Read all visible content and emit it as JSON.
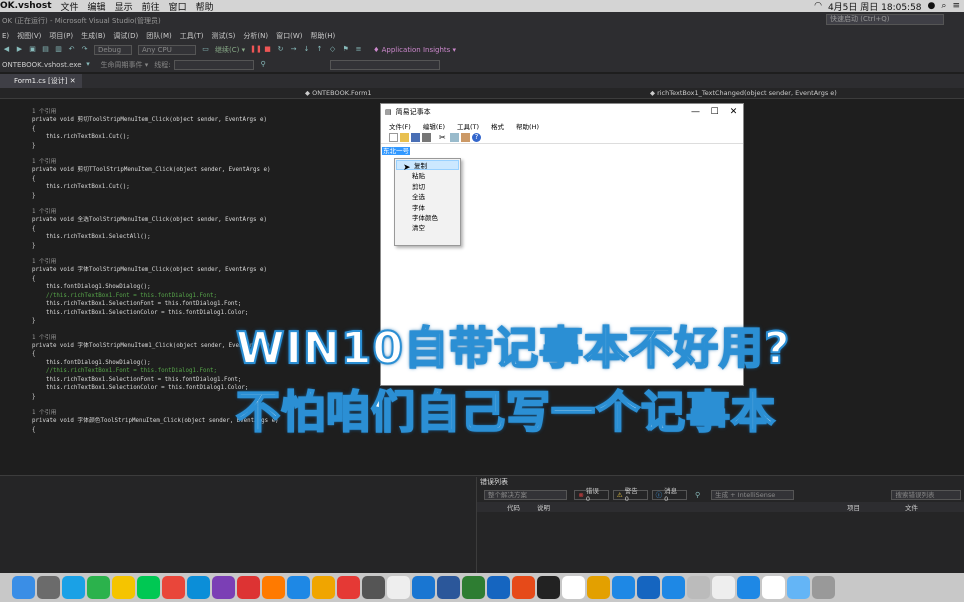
{
  "mac_menubar": {
    "app_name": "OK.vshost",
    "menus": [
      "文件",
      "编辑",
      "显示",
      "前往",
      "窗口",
      "帮助"
    ],
    "clock": "4月5日 周日 18:05:58"
  },
  "vs": {
    "window_title": "OK (正在运行) - Microsoft Visual Studio(管理员)",
    "quick_launch_placeholder": "快速启动 (Ctrl+Q)",
    "menu": [
      "E)",
      "视图(V)",
      "项目(P)",
      "生成(B)",
      "调试(D)",
      "团队(M)",
      "工具(T)",
      "测试(S)",
      "分析(N)",
      "窗口(W)",
      "帮助(H)"
    ],
    "config_combo": "Debug",
    "platform_combo": "Any CPU",
    "continue_label": "继续(C) ▾",
    "app_insights": "Application Insights",
    "process_combo": "ONTEBOOK.vshost.exe",
    "lifecycle_label": "生命周期事件 ▾",
    "thread_label": "线程:",
    "doc_tab": "Form1.cs [设计]",
    "nav_class": "ONTEBOOK.Form1",
    "nav_member": "richTextBox1_TextChanged(object sender, EventArgs e)"
  },
  "code_lines": [
    {
      "ref": "1 个引用",
      "text": "private void 剪切ToolStripMenuItem_Click(object sender, EventArgs e)"
    },
    {
      "text": "{"
    },
    {
      "text": "    this.richTextBox1.Cut();"
    },
    {
      "text": "}"
    },
    {
      "ref": "1 个引用",
      "text": "private void 剪切TToolStripMenuItem_Click(object sender, EventArgs e)"
    },
    {
      "text": "{"
    },
    {
      "text": "    this.richTextBox1.Cut();"
    },
    {
      "text": "}"
    },
    {
      "ref": "1 个引用",
      "text": "private void 全选ToolStripMenuItem_Click(object sender, EventArgs e)"
    },
    {
      "text": "{"
    },
    {
      "text": "    this.richTextBox1.SelectAll();"
    },
    {
      "text": "}"
    },
    {
      "ref": "1 个引用",
      "text": "private void 字体ToolStripMenuItem_Click(object sender, EventArgs e)"
    },
    {
      "text": "{"
    },
    {
      "text": "    this.fontDialog1.ShowDialog();"
    },
    {
      "text": "    //this.richTextBox1.Font = this.fontDialog1.Font;",
      "comment": true
    },
    {
      "text": "    this.richTextBox1.SelectionFont = this.fontDialog1.Font;"
    },
    {
      "text": "    this.richTextBox1.SelectionColor = this.fontDialog1.Color;"
    },
    {
      "text": "}"
    },
    {
      "ref": "1 个引用",
      "text": "private void 字体ToolStripMenuItem1_Click(object sender, EventArgs e)"
    },
    {
      "text": "{"
    },
    {
      "text": "    this.fontDialog1.ShowDialog();"
    },
    {
      "text": "    //this.richTextBox1.Font = this.fontDialog1.Font;",
      "comment": true
    },
    {
      "text": "    this.richTextBox1.SelectionFont = this.fontDialog1.Font;"
    },
    {
      "text": "    this.richTextBox1.SelectionColor = this.fontDialog1.Color;"
    },
    {
      "text": "}"
    },
    {
      "ref": "1 个引用",
      "text": "private void 字体颜色ToolStripMenuItem_Click(object sender, EventArgs e)"
    },
    {
      "text": "{"
    }
  ],
  "error_list": {
    "title": "错误列表",
    "scope_combo": "整个解决方案",
    "errors": "错误 0",
    "warnings": "警告 0",
    "messages": "消息 0",
    "build_combo": "生成 + IntelliSense",
    "search_placeholder": "搜索错误列表",
    "columns": [
      "代码",
      "说明",
      "项目",
      "文件"
    ]
  },
  "notepad": {
    "title": "简易记事本",
    "menu": [
      "文件(F)",
      "编辑(E)",
      "工具(T)",
      "格式",
      "帮助(H)"
    ],
    "selected_text": "东北一号",
    "context_menu": [
      "复制",
      "粘贴",
      "剪切",
      "全选",
      "字体",
      "字体颜色",
      "清空"
    ],
    "highlighted_index": 0
  },
  "overlay": {
    "line1": "WIN10自带记事本不好用?",
    "line2": "不怕咱们自己写一个记事本"
  },
  "dock_icons": [
    "finder-icon",
    "launchpad-icon",
    "qq-icon",
    "video-icon",
    "music-icon",
    "iqiyi-icon",
    "chrome-icon",
    "teamviewer-icon",
    "visual-studio-icon",
    "record-icon",
    "firefox-icon",
    "kugou-icon",
    "tool-icon",
    "app-icon",
    "clapper-icon",
    "game-icon",
    "qiyu-icon",
    "word-icon",
    "wechat-icon",
    "xcode-icon",
    "ball-icon",
    "pubg-icon",
    "calendar-icon",
    "box-icon",
    "feishu-icon",
    "wps-icon",
    "shield-icon",
    "scan-icon",
    "thermometer-icon",
    "vpn-icon",
    "doc-icon",
    "folder-icon",
    "trash-icon"
  ],
  "colors": {
    "vs_bg": "#1e1e1e",
    "selection": "#3399ff",
    "overlay_stroke": "#2b8fd4"
  }
}
